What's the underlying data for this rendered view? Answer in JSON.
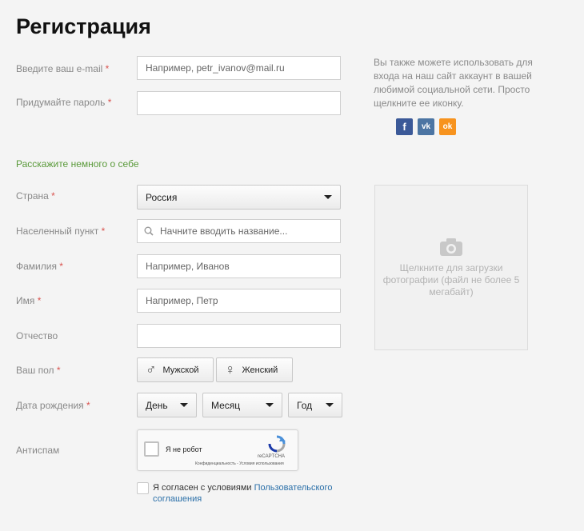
{
  "page": {
    "title": "Регистрация"
  },
  "account": {
    "email_label": "Введите ваш e-mail",
    "email_placeholder": "Например, petr_ivanov@mail.ru",
    "password_label": "Придумайте пароль",
    "required_mark": "*"
  },
  "social": {
    "text": "Вы также можете использовать для входа на наш сайт аккаунт в вашей любимой социальной сети. Просто щелкните ее иконку.",
    "facebook_glyph": "f",
    "vk_glyph": "vk",
    "ok_glyph": "ok",
    "colors": {
      "facebook": "#3b5998",
      "vk": "#4c75a3",
      "ok": "#f7931e"
    }
  },
  "about": {
    "section_title": "Расскажите немного о себе",
    "country_label": "Страна",
    "country_value": "Россия",
    "city_label": "Населенный пункт",
    "city_placeholder": "Начните вводить название...",
    "surname_label": "Фамилия",
    "surname_placeholder": "Например, Иванов",
    "name_label": "Имя",
    "name_placeholder": "Например, Петр",
    "patronymic_label": "Отчество",
    "gender_label": "Ваш пол",
    "gender_male": "Мужской",
    "gender_female": "Женский",
    "gender_male_glyph": "♂",
    "gender_female_glyph": "♀",
    "birthdate_label": "Дата рождения",
    "day": "День",
    "month": "Месяц",
    "year": "Год",
    "antispam_label": "Антиспам"
  },
  "photo": {
    "text": "Щелкните для загрузки фотографии (файл не более 5 мегабайт)"
  },
  "captcha": {
    "label": "Я не робот",
    "brand": "reCAPTCHA",
    "links": "Конфиденциальность - Условия использования"
  },
  "agree": {
    "text": "Я согласен с условиями ",
    "link": "Пользовательского соглашения"
  },
  "colors": {
    "accent_green": "#5a9a3a",
    "required_red": "#d9534f",
    "link_blue": "#2a6fa8"
  }
}
